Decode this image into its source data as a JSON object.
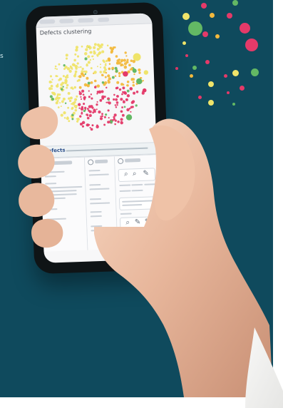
{
  "scene": {
    "visible_left_text": "s",
    "screen_title": "Defects clustering",
    "details_label": "Defects"
  },
  "visual": {
    "panel_color": "#0f4a5d",
    "phone_color": "#0f1416",
    "screen_color": "#f7f7f8",
    "dot_palette": [
      "#e43a69",
      "#f2b93d",
      "#efe46a",
      "#63b864",
      "#ffffff"
    ],
    "icons": [
      "camera-icon",
      "search-icon",
      "edit-icon",
      "close-icon",
      "folder-icon"
    ]
  }
}
